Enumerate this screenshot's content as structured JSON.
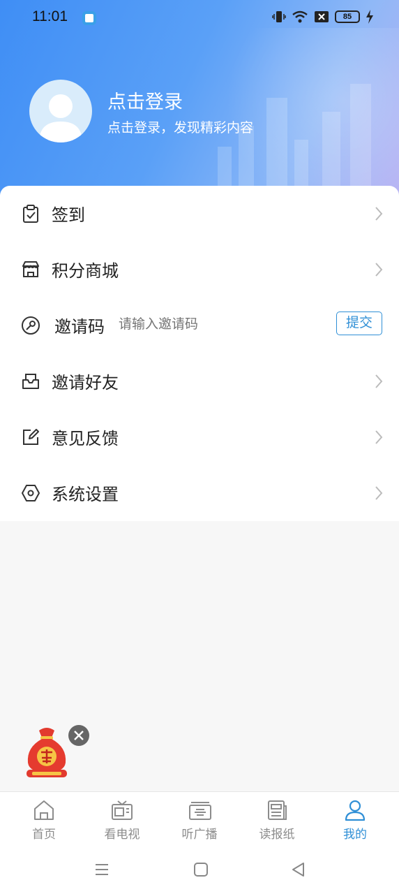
{
  "status_bar": {
    "time": "11:01",
    "battery": "85"
  },
  "profile": {
    "login_title": "点击登录",
    "login_subtitle": "点击登录，发现精彩内容"
  },
  "menu": {
    "checkin": "签到",
    "points_mall": "积分商城",
    "invite_code": {
      "label": "邀请码",
      "placeholder": "请输入邀请码",
      "submit": "提交"
    },
    "invite_friends": "邀请好友",
    "feedback": "意见反馈",
    "settings": "系统设置"
  },
  "tabs": [
    {
      "label": "首页",
      "icon": "home-icon"
    },
    {
      "label": "看电视",
      "icon": "tv-icon"
    },
    {
      "label": "听广播",
      "icon": "radio-icon"
    },
    {
      "label": "读报纸",
      "icon": "newspaper-icon"
    },
    {
      "label": "我的",
      "icon": "user-icon",
      "active": true
    }
  ],
  "colors": {
    "accent": "#2f8fd6",
    "header_start": "#3f8ef5",
    "header_end": "#b9b2f3"
  }
}
